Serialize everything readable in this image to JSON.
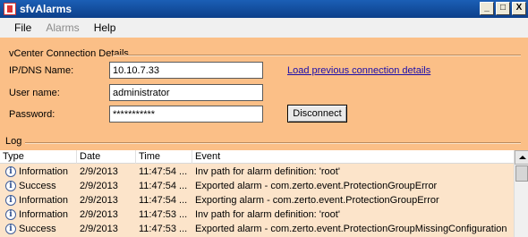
{
  "window": {
    "title": "sfvAlarms",
    "controls": [
      "_",
      "□",
      "X"
    ]
  },
  "menu": [
    {
      "label": "File",
      "enabled": true
    },
    {
      "label": "Alarms",
      "enabled": false
    },
    {
      "label": "Help",
      "enabled": true
    }
  ],
  "connection": {
    "group_title": "vCenter Connection Details",
    "ip_label": "IP/DNS Name:",
    "ip_value": "10.10.7.33",
    "user_label": "User name:",
    "user_value": "administrator",
    "password_label": "Password:",
    "password_value": "***********",
    "load_link": "Load previous connection details",
    "disconnect_label": "Disconnect"
  },
  "log": {
    "title": "Log",
    "columns": [
      "Type",
      "Date",
      "Time",
      "Event"
    ],
    "rows": [
      {
        "type": "Information",
        "date": "2/9/2013",
        "time": "11:47:54 ...",
        "event": "Inv path for alarm definition: 'root'"
      },
      {
        "type": "Success",
        "date": "2/9/2013",
        "time": "11:47:54 ...",
        "event": "Exported alarm - com.zerto.event.ProtectionGroupError"
      },
      {
        "type": "Information",
        "date": "2/9/2013",
        "time": "11:47:54 ...",
        "event": "Exporting alarm - com.zerto.event.ProtectionGroupError"
      },
      {
        "type": "Information",
        "date": "2/9/2013",
        "time": "11:47:53 ...",
        "event": "Inv path for alarm definition: 'root'"
      },
      {
        "type": "Success",
        "date": "2/9/2013",
        "time": "11:47:53 ...",
        "event": "Exported alarm - com.zerto.event.ProtectionGroupMissingConfiguration"
      }
    ]
  },
  "colors": {
    "panel": "#fbbf87",
    "titlebar": "#1b5fb5",
    "link": "#1a0dab"
  },
  "icons": {
    "row_type": "info-icon"
  }
}
